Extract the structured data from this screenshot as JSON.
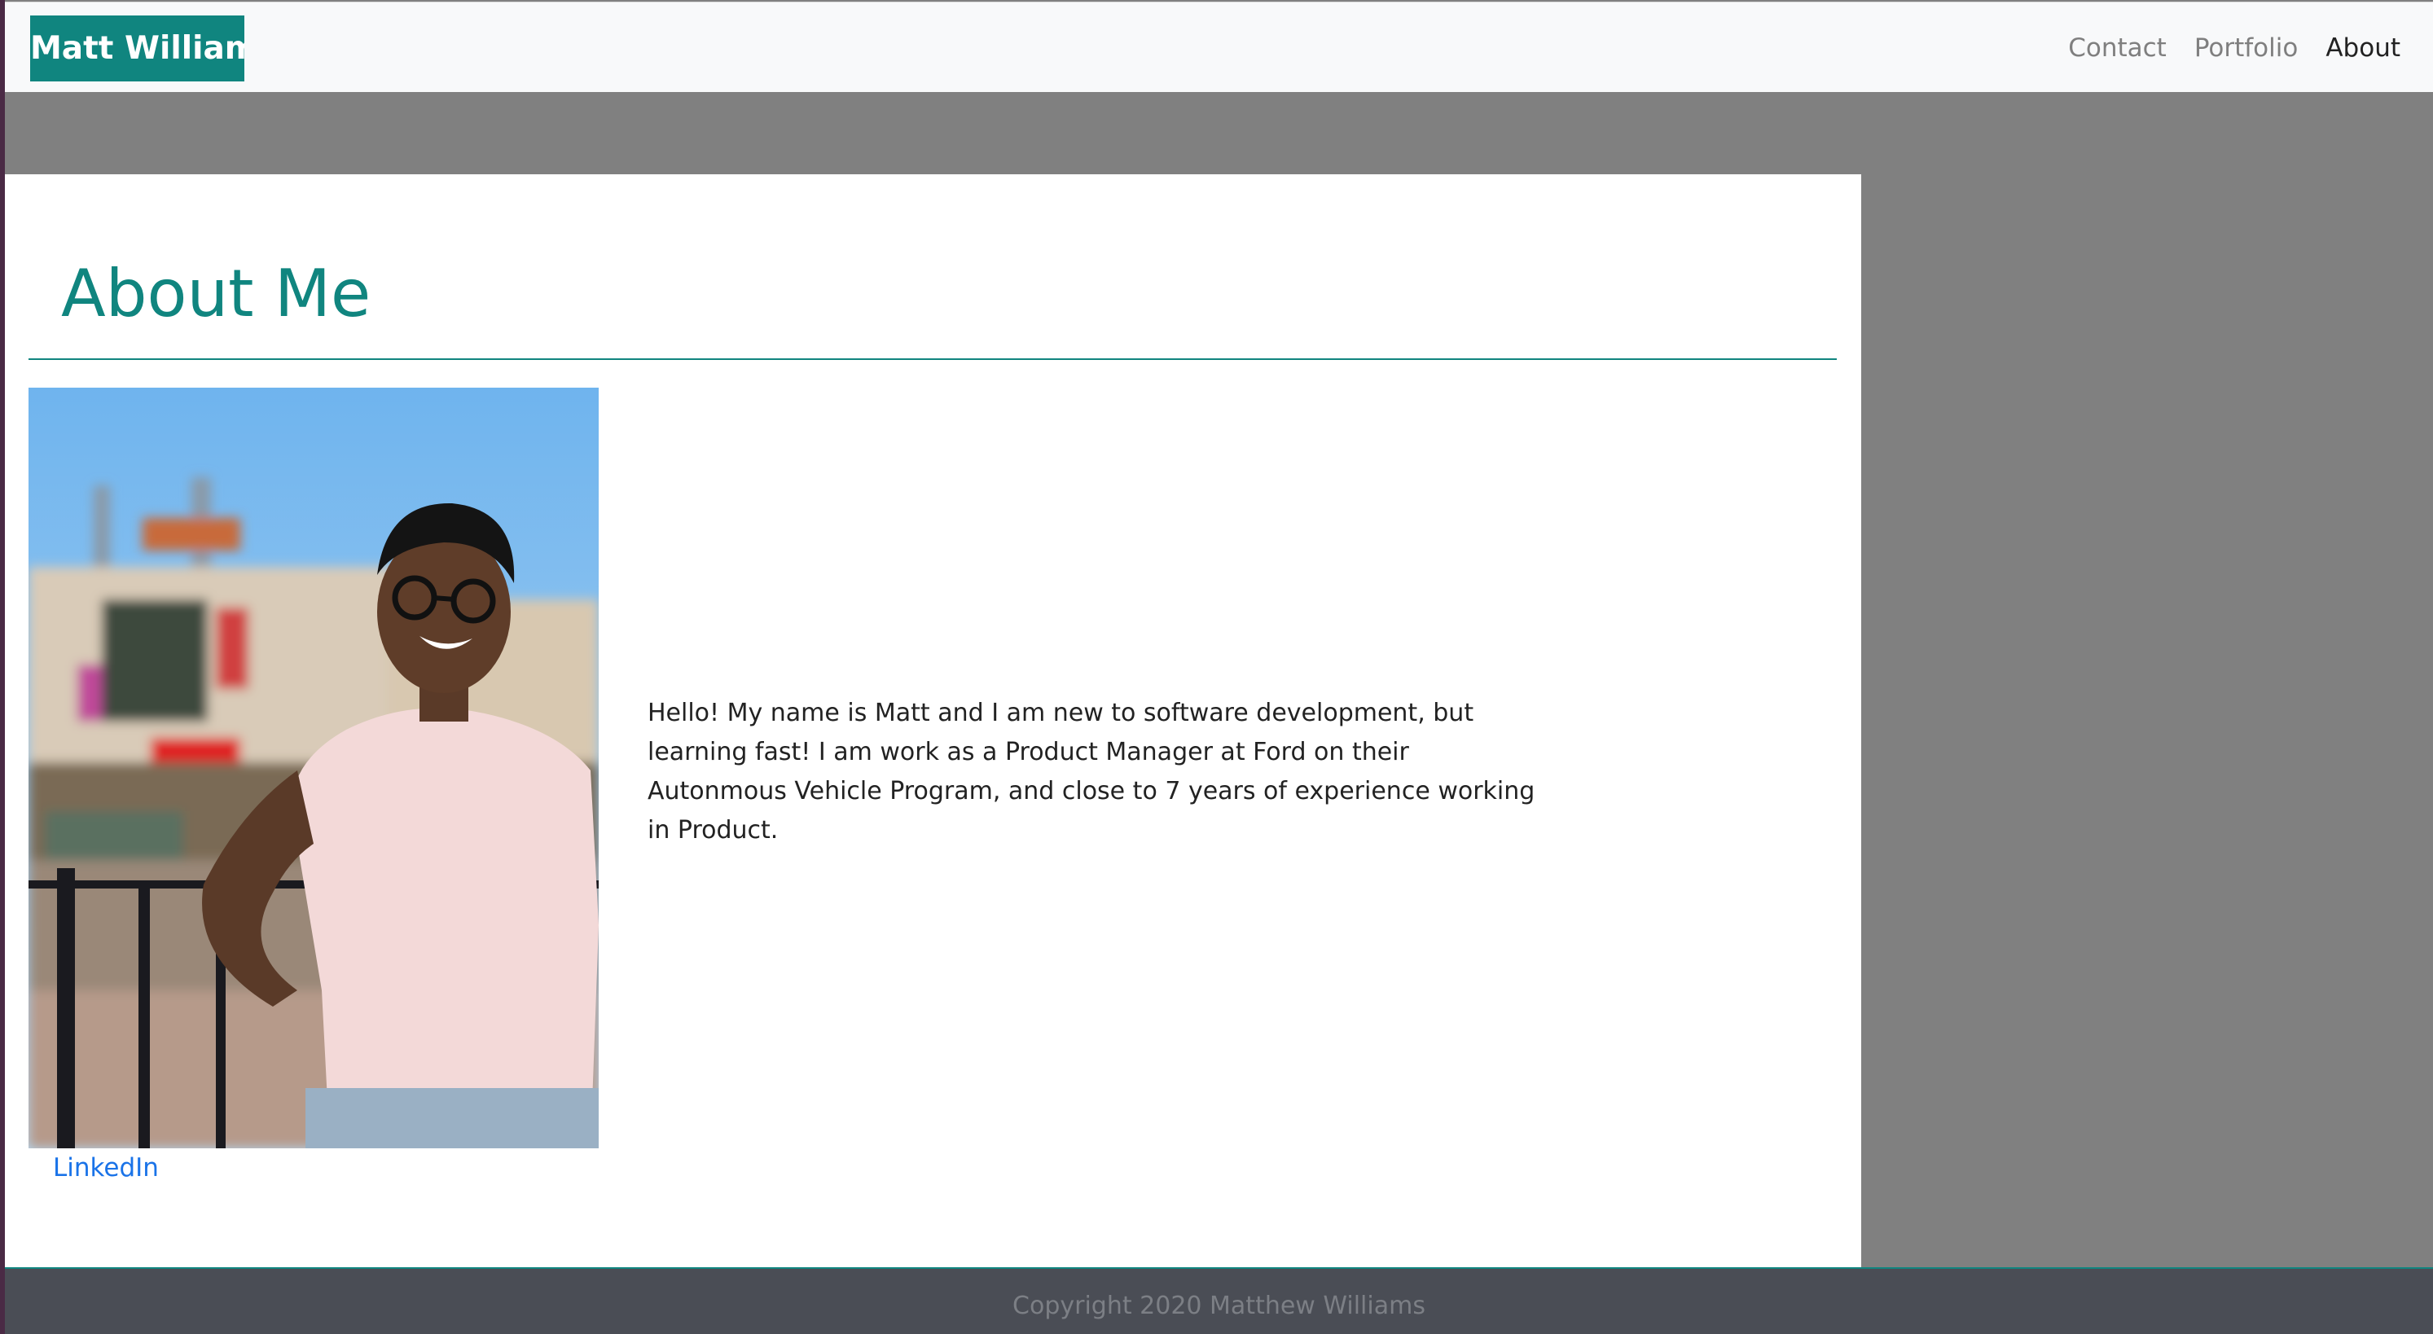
{
  "navbar": {
    "brand": "Matt Williams",
    "links": [
      {
        "label": "Contact"
      },
      {
        "label": "Portfolio"
      },
      {
        "label": "About",
        "active": true
      }
    ]
  },
  "main": {
    "title": "About Me",
    "bio": "Hello! My name is Matt and I am new to software development, but learning fast! I am work as a Product Manager at Ford on their Autonmous Vehicle Program, and close to 7 years of experience working in Product.",
    "linkedin_label": "LinkedIn"
  },
  "footer": {
    "text": "Copyright 2020 Matthew Williams"
  },
  "colors": {
    "brand": "#10857f",
    "page_background": "#808080",
    "footer_background": "#4a4d55",
    "link": "#1a73e8"
  }
}
